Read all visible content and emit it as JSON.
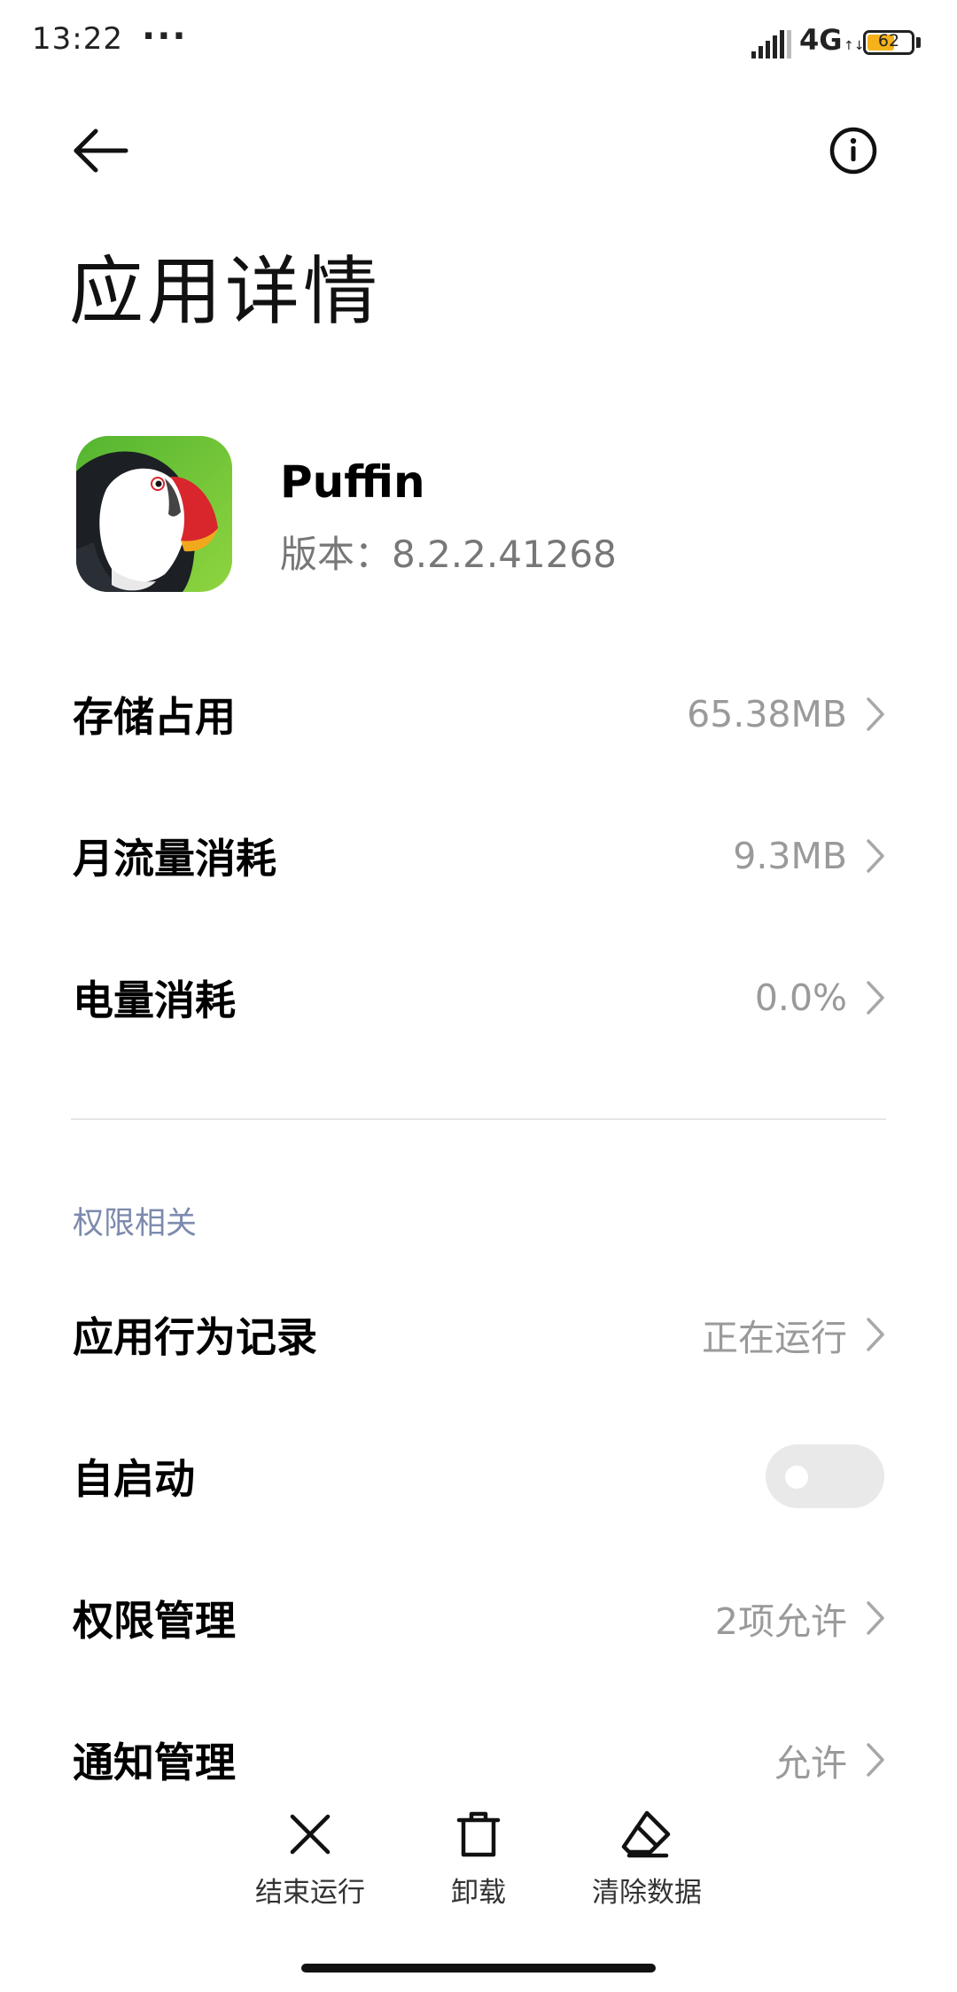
{
  "status_bar": {
    "time": "13:22",
    "more_dots": "···",
    "network": "4G",
    "network_arrows": "↑↓",
    "battery_level": "62",
    "battery_fraction": 0.62,
    "battery_color": "#f5b21a"
  },
  "header": {
    "back_icon": "arrow-left-icon",
    "info_icon": "info-icon",
    "title": "应用详情"
  },
  "app": {
    "icon": "puffin-app-icon",
    "name": "Puffin",
    "version_label": "版本：",
    "version": "8.2.2.41268"
  },
  "stats": [
    {
      "label": "存储占用",
      "value": "65.38MB"
    },
    {
      "label": "月流量消耗",
      "value": "9.3MB"
    },
    {
      "label": "电量消耗",
      "value": "0.0%"
    }
  ],
  "permissions_section": {
    "title": "权限相关",
    "items": [
      {
        "label": "应用行为记录",
        "value": "正在运行"
      },
      {
        "label": "自启动",
        "toggle_on": false
      },
      {
        "label": "权限管理",
        "value": "2项允许"
      },
      {
        "label": "通知管理",
        "value": "允许"
      }
    ]
  },
  "bottom_actions": [
    {
      "label": "结束运行",
      "icon": "close-icon"
    },
    {
      "label": "卸载",
      "icon": "trash-icon"
    },
    {
      "label": "清除数据",
      "icon": "eraser-icon"
    }
  ],
  "colors": {
    "accent_section": "#7d8aae",
    "value_gray": "#9a9a9a",
    "icon_green": "#6cc13b"
  }
}
